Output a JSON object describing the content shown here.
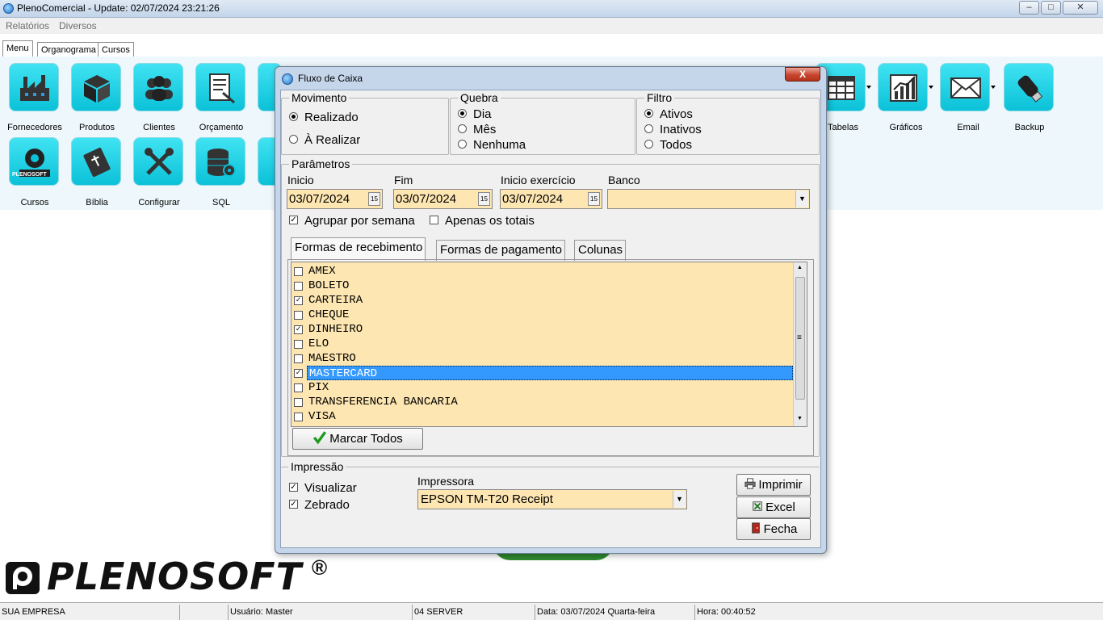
{
  "window": {
    "title": "PlenoComercial - Update: 02/07/2024 23:21:26",
    "min_label": "–",
    "max_label": "□",
    "close_label": "✕"
  },
  "menubar": [
    "Relatórios",
    "Diversos"
  ],
  "main_tabs": [
    "Menu",
    "Organograma",
    "Cursos"
  ],
  "launcher": {
    "row1": [
      "Fornecedores",
      "Produtos",
      "Clientes",
      "Orçamento",
      "Tabelas",
      "Gráficos",
      "Email",
      "Backup"
    ],
    "row2": [
      "Cursos",
      "Bíblia",
      "Configurar",
      "SQL"
    ],
    "cursos_icon_text": "PLENOSOFT",
    "accent": "#0bc1d8"
  },
  "logo": {
    "text": "PLENOSOFT",
    "reg": "®"
  },
  "statusbar": {
    "company": "SUA EMPRESA",
    "empty": "",
    "user": "Usuário: Master",
    "server": "04 SERVER",
    "date": "Data: 03/07/2024 Quarta-feira",
    "time": "Hora: 00:40:52"
  },
  "dialog": {
    "title": "Fluxo de Caixa",
    "close": "X",
    "movimento": {
      "title": "Movimento",
      "options": [
        {
          "label": "Realizado",
          "checked": true
        },
        {
          "label": "À Realizar",
          "checked": false
        }
      ]
    },
    "quebra": {
      "title": "Quebra",
      "options": [
        {
          "label": "Dia",
          "checked": true
        },
        {
          "label": "Mês",
          "checked": false
        },
        {
          "label": "Nenhuma",
          "checked": false
        }
      ]
    },
    "filtro": {
      "title": "Filtro",
      "options": [
        {
          "label": "Ativos",
          "checked": true
        },
        {
          "label": "Inativos",
          "checked": false
        },
        {
          "label": "Todos",
          "checked": false
        }
      ]
    },
    "parametros": {
      "title": "Parâmetros",
      "inicio_label": "Inicio",
      "inicio_value": "03/07/2024",
      "fim_label": "Fim",
      "fim_value": "03/07/2024",
      "inicio_exercicio_label": "Inicio exercício",
      "inicio_exercicio_value": "03/07/2024",
      "banco_label": "Banco",
      "banco_value": "",
      "cal_icon": "15",
      "agrupar_label": "Agrupar por semana",
      "agrupar_checked": true,
      "apenas_totais_label": "Apenas os totais",
      "apenas_totais_checked": false
    },
    "tabs": [
      "Formas de recebimento",
      "Formas de pagamento",
      "Colunas"
    ],
    "formas": [
      {
        "label": "AMEX",
        "checked": false
      },
      {
        "label": "BOLETO",
        "checked": false
      },
      {
        "label": "CARTEIRA",
        "checked": true
      },
      {
        "label": "CHEQUE",
        "checked": false
      },
      {
        "label": "DINHEIRO",
        "checked": true
      },
      {
        "label": "ELO",
        "checked": false
      },
      {
        "label": "MAESTRO",
        "checked": false
      },
      {
        "label": "MASTERCARD",
        "checked": true,
        "selected": true
      },
      {
        "label": "PIX",
        "checked": false
      },
      {
        "label": "TRANSFERENCIA BANCARIA",
        "checked": false
      },
      {
        "label": "VISA",
        "checked": false
      }
    ],
    "scroll_up": "▲",
    "scroll_down": "▼",
    "scroll_grip": "≡",
    "marcar_todos": "Marcar Todos",
    "impressao": {
      "title": "Impressão",
      "visualizar_label": "Visualizar",
      "visualizar_checked": true,
      "zebrado_label": "Zebrado",
      "zebrado_checked": true,
      "impressora_label": "Impressora",
      "impressora_value": "EPSON TM-T20 Receipt"
    },
    "buttons": {
      "imprimir": "Imprimir",
      "excel": "Excel",
      "fecha": "Fecha"
    }
  }
}
